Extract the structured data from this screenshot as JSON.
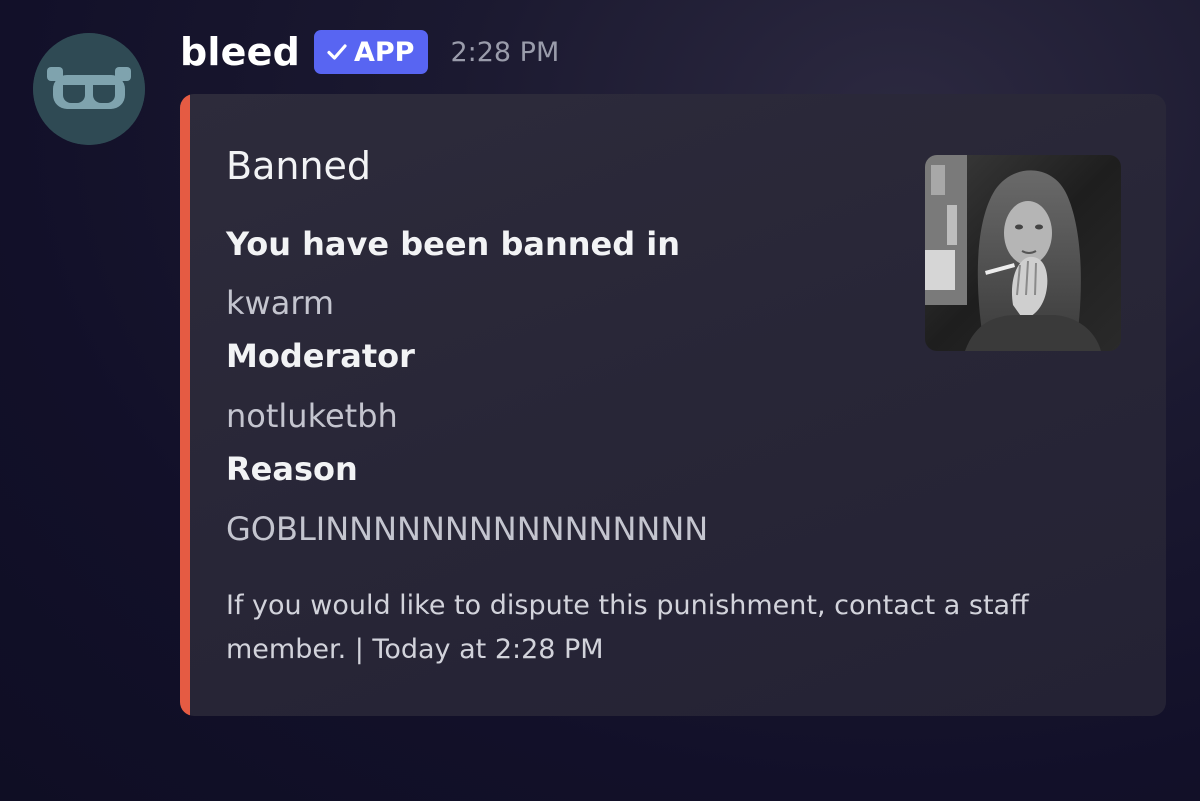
{
  "message": {
    "username": "bleed",
    "badge_label": "APP",
    "timestamp": "2:28 PM",
    "avatar_icon": "goggles-bot-icon"
  },
  "embed": {
    "accent_color": "#e55b43",
    "title": "Banned",
    "fields": [
      {
        "name": "You have been banned in",
        "value": "kwarm"
      },
      {
        "name": "Moderator",
        "value": "notluketbh"
      },
      {
        "name": "Reason",
        "value": "GOBLINNNNNNNNNNNNNNNN"
      }
    ],
    "footer": "If you would like to dispute this punishment, contact a staff member. | Today at 2:28 PM",
    "thumbnail": "user-photo-thumbnail"
  },
  "colors": {
    "badge": "#5865f2",
    "avatar_bg": "#2f4a54"
  }
}
